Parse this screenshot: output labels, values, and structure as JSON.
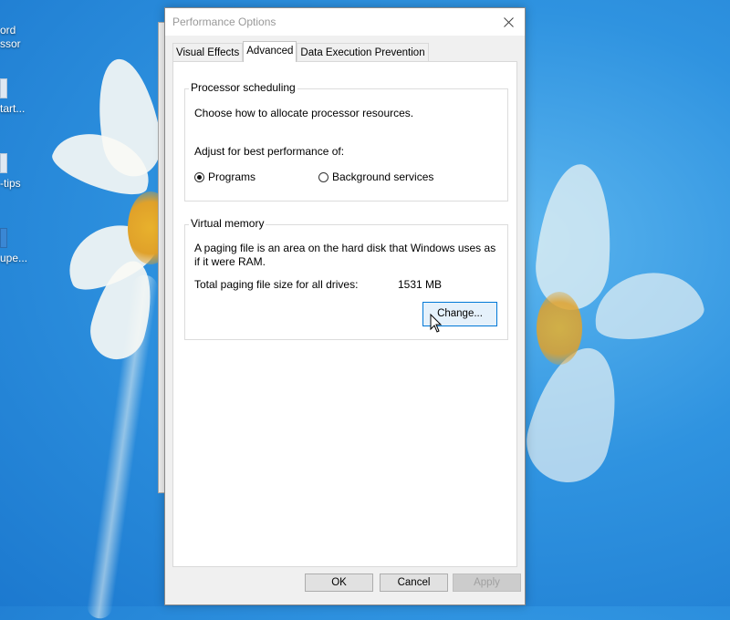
{
  "window": {
    "title": "Performance Options"
  },
  "tabs": [
    {
      "label": "Visual Effects"
    },
    {
      "label": "Advanced"
    },
    {
      "label": "Data Execution Prevention"
    }
  ],
  "processor_scheduling": {
    "legend": "Processor scheduling",
    "description": "Choose how to allocate processor resources.",
    "adjust_label": "Adjust for best performance of:",
    "options": [
      {
        "label": "Programs",
        "selected": true
      },
      {
        "label": "Background services",
        "selected": false
      }
    ]
  },
  "virtual_memory": {
    "legend": "Virtual memory",
    "description_line1": "A paging file is an area on the hard disk that Windows uses as",
    "description_line2": "if it were RAM.",
    "total_label": "Total paging file size for all drives:",
    "total_value": "1531 MB",
    "change_button": "Change..."
  },
  "footer": {
    "ok": "OK",
    "cancel": "Cancel",
    "apply": "Apply"
  },
  "desktop_icons": [
    {
      "label_line1": "ord",
      "label_line2": "ssor"
    },
    {
      "label_line1": "tart..."
    },
    {
      "label_line1": "-tips"
    },
    {
      "label_line1": "upe..."
    }
  ]
}
